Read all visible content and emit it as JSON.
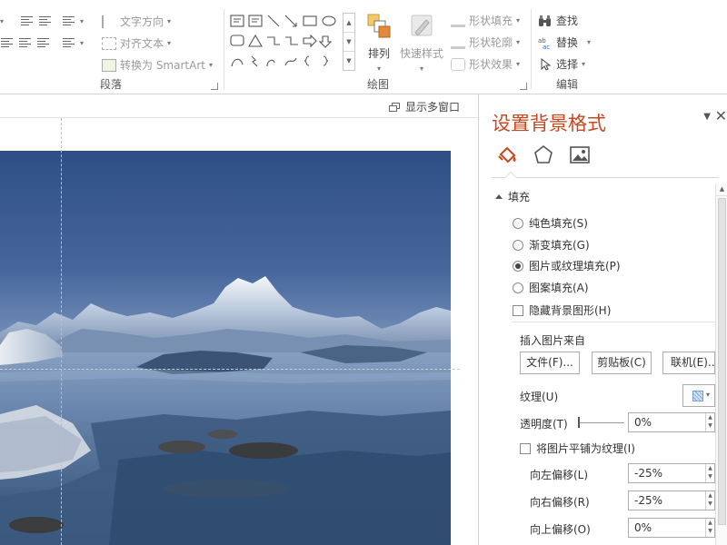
{
  "ribbon": {
    "paragraph": {
      "text_direction": "文字方向",
      "align_text": "对齐文本",
      "convert_smartart": "转换为 SmartArt",
      "label": "段落"
    },
    "drawing": {
      "arrange": "排列",
      "quick_styles": "快速样式",
      "shape_fill": "形状填充",
      "shape_outline": "形状轮廓",
      "shape_effects": "形状效果",
      "label": "绘图"
    },
    "editing": {
      "find": "查找",
      "replace": "替换",
      "select": "选择",
      "label": "编辑"
    }
  },
  "workspace": {
    "multi_window": "显示多窗口"
  },
  "pane": {
    "title": "设置背景格式",
    "tabs": [
      "fill-tab",
      "effects-tab",
      "picture-tab"
    ],
    "section": "填充",
    "fill_options": [
      {
        "label": "纯色填充(S)",
        "selected": false
      },
      {
        "label": "渐变填充(G)",
        "selected": false
      },
      {
        "label": "图片或纹理填充(P)",
        "selected": true
      },
      {
        "label": "图案填充(A)",
        "selected": false
      }
    ],
    "hide_bg_graphics": "隐藏背景图形(H)",
    "insert_from": "插入图片来自",
    "btn_file": "文件(F)...",
    "btn_clipboard": "剪贴板(C)",
    "btn_online": "联机(E)...",
    "texture_label": "纹理(U)",
    "transparency_label": "透明度(T)",
    "transparency_value": "0%",
    "tile_label": "将图片平铺为纹理(I)",
    "offset_left_label": "向左偏移(L)",
    "offset_left_value": "-25%",
    "offset_right_label": "向右偏移(R)",
    "offset_right_value": "-25%",
    "offset_top_label": "向上偏移(O)",
    "offset_top_value": "0%"
  },
  "colors": {
    "accent": "#c9461f"
  }
}
